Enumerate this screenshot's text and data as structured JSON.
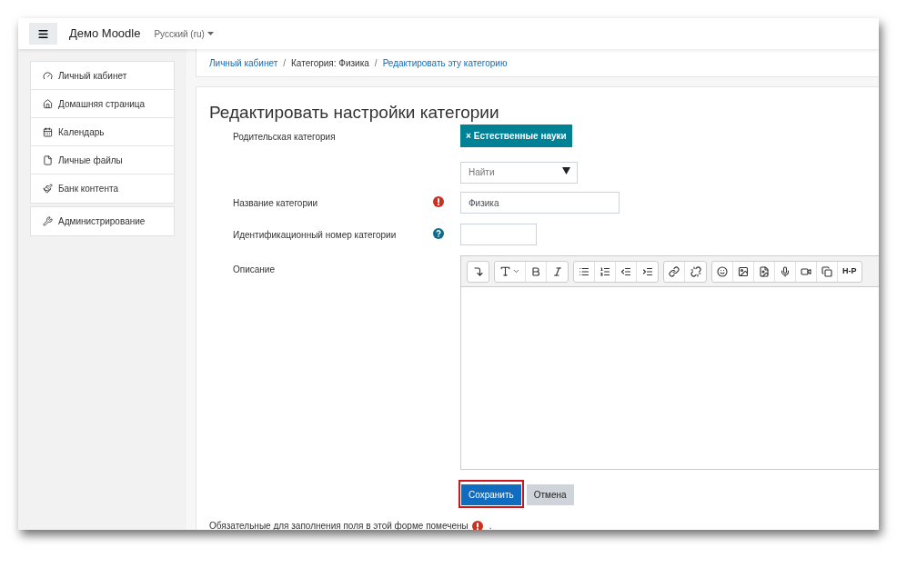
{
  "navbar": {
    "site_name": "Демо Moodle",
    "language": "Русский (ru)"
  },
  "sidebar": {
    "groups": [
      {
        "items": [
          "Личный кабинет",
          "Домашняя страница",
          "Календарь",
          "Личные файлы",
          "Банк контента"
        ]
      },
      {
        "items": [
          "Администрирование"
        ]
      }
    ]
  },
  "breadcrumb": [
    {
      "label": "Личный кабинет",
      "link": true
    },
    {
      "separator": "/",
      "label": "Категория: Физика",
      "link": false
    },
    {
      "separator": "/",
      "label": "Редактировать эту категорию",
      "link": true
    }
  ],
  "form": {
    "title": "Редактировать настройки категории",
    "fields": [
      {
        "kind": "autocomplete",
        "label": "Родительская категория",
        "tag_remove": "×",
        "tag": "Естественные науки",
        "placeholder": "Найти"
      },
      {
        "kind": "text",
        "label": "Название категории",
        "required": true,
        "value": "Физика"
      },
      {
        "kind": "text",
        "label": "Идентификационный номер категории",
        "help": true
      },
      {
        "kind": "editor",
        "label": "Описание",
        "toolbar": [
          [
            {
              "kind": "collapse"
            }
          ],
          [
            {
              "kind": "font"
            },
            {
              "kind": "bold"
            },
            {
              "kind": "italic"
            }
          ],
          [
            {
              "kind": "bullets"
            },
            {
              "kind": "numbers"
            },
            {
              "kind": "outdent"
            },
            {
              "kind": "indent"
            }
          ],
          [
            {
              "kind": "link"
            },
            {
              "kind": "unlink"
            }
          ],
          [
            {
              "kind": "emoji"
            },
            {
              "kind": "image"
            },
            {
              "kind": "media"
            },
            {
              "kind": "mic"
            },
            {
              "kind": "video"
            },
            {
              "kind": "files"
            },
            {
              "kind": "h5p",
              "label": "H-P"
            }
          ]
        ]
      }
    ],
    "buttons": [
      {
        "label": "Сохранить",
        "primary": true,
        "highlighted": true
      },
      {
        "label": "Отмена",
        "primary": false,
        "highlighted": false
      }
    ],
    "note": "Обязательные для заполнения поля в этой форме помечены",
    "note_end": "."
  }
}
